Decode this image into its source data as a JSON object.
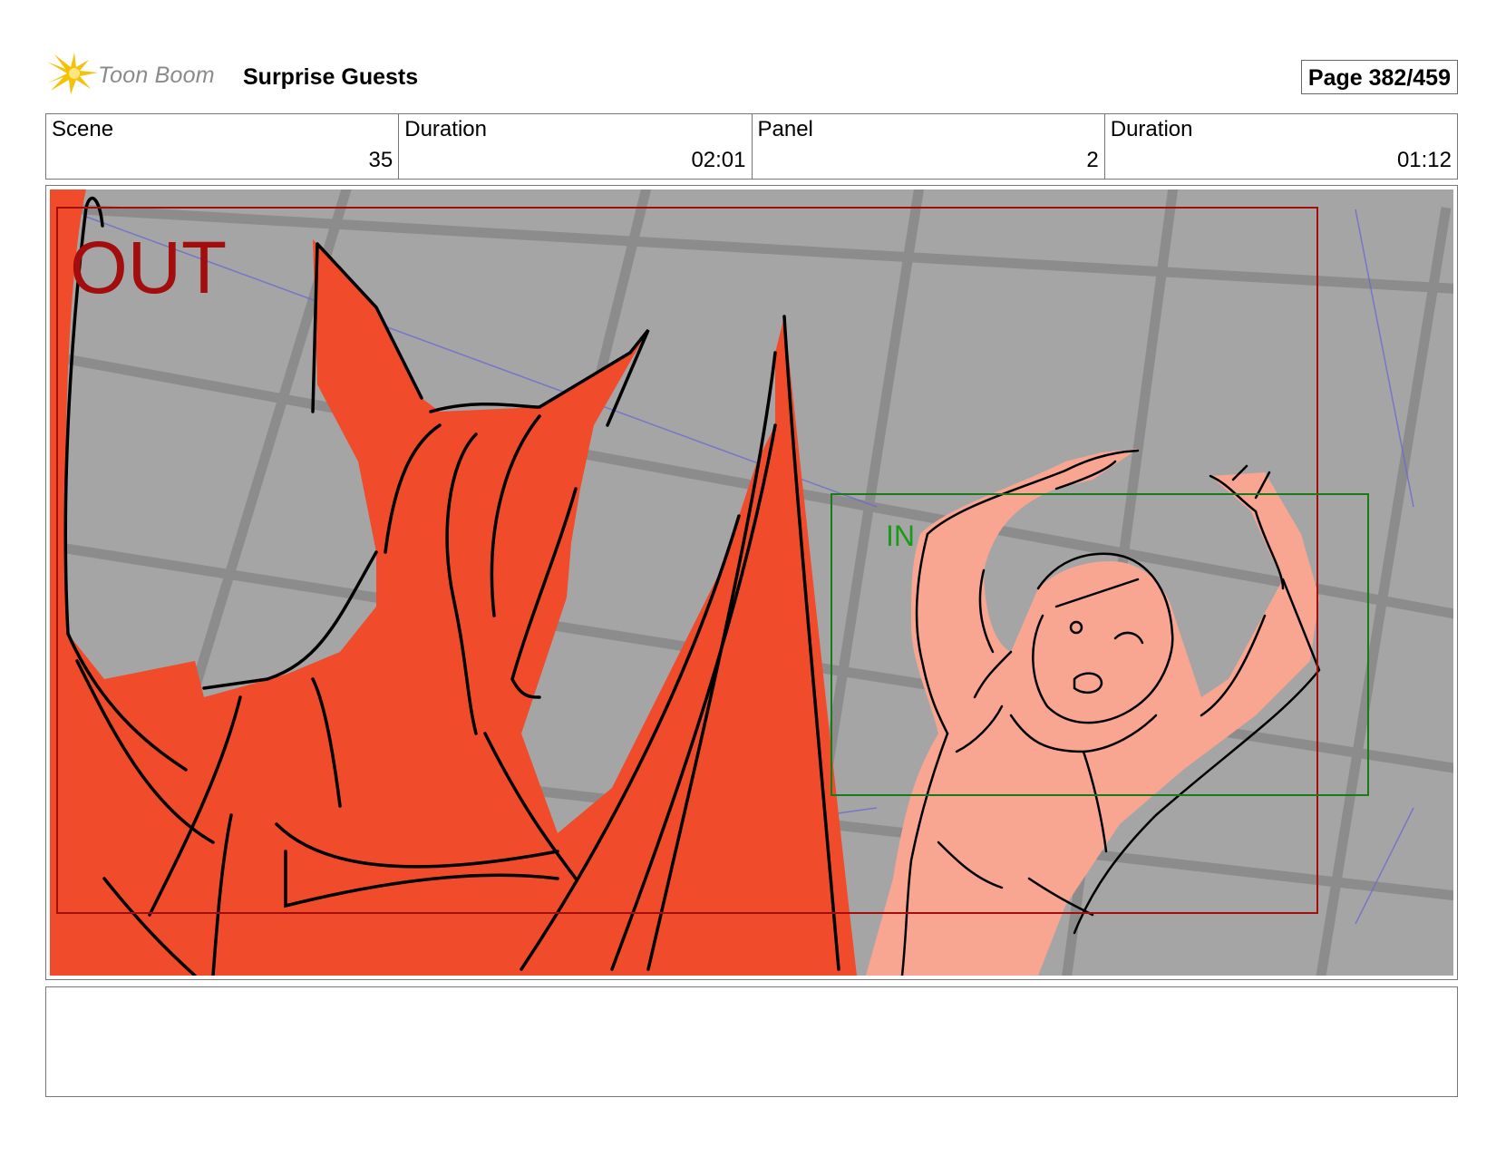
{
  "header": {
    "logo_text": "Toon Boom",
    "project_title": "Surprise Guests",
    "page_label": "Page 382/459"
  },
  "info": {
    "scene_label": "Scene",
    "scene_value": "35",
    "scene_duration_label": "Duration",
    "scene_duration_value": "02:01",
    "panel_label": "Panel",
    "panel_value": "2",
    "panel_duration_label": "Duration",
    "panel_duration_value": "01:12"
  },
  "panel": {
    "out_label": "OUT",
    "in_label": "IN",
    "colors": {
      "background": "#a5a5a5",
      "grid": "#8a8a8a",
      "creature": "#f04b2b",
      "character": "#f8a692",
      "out_frame": "#a40d0d",
      "in_frame": "#1a7a1a",
      "camera_lines": "#6a6ad0"
    }
  },
  "notes": {
    "text": ""
  }
}
